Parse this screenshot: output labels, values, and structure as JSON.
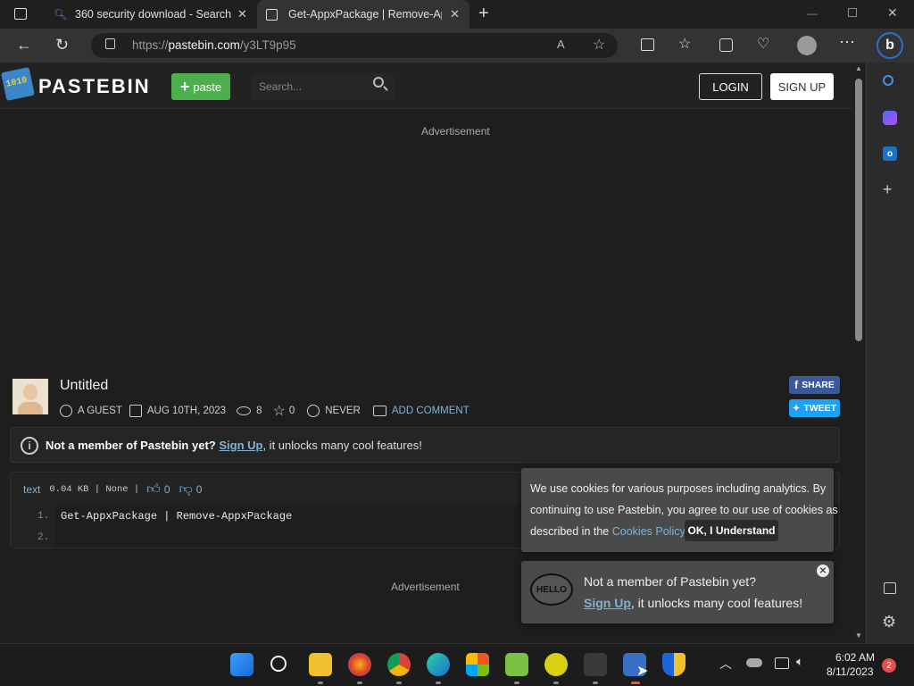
{
  "browser": {
    "tabs": [
      {
        "label": "360 security download - Search"
      },
      {
        "label": "Get-AppxPackage | Remove-AppxPackage"
      }
    ],
    "url_prefix": "https://",
    "url_domain": "pastebin.com",
    "url_path": "/y3LT9p95"
  },
  "header": {
    "logo_text": "PASTEBIN",
    "logo_icon_text": "1010",
    "paste_button": "paste",
    "search_placeholder": "Search...",
    "login": "LOGIN",
    "signup": "SIGN UP"
  },
  "ad_label_top": "Advertisement",
  "ad_label_bottom": "Advertisement",
  "paste": {
    "title": "Untitled",
    "author": "A GUEST",
    "date": "AUG 10TH, 2023",
    "views": "8",
    "stars": "0",
    "expires": "NEVER",
    "add_comment": "ADD COMMENT",
    "share": "SHARE",
    "tweet": "TWEET"
  },
  "notice": {
    "bold": "Not a member of Pastebin yet?",
    "link": "Sign Up",
    "rest": ", it unlocks many cool features!"
  },
  "code": {
    "syntax": "text",
    "size": "0.04 KB | None |",
    "likes": "0",
    "dislikes": "0",
    "lines": [
      {
        "num": "1.",
        "text": "Get-AppxPackage | Remove-AppxPackage"
      },
      {
        "num": "2.",
        "text": ""
      }
    ]
  },
  "cookie": {
    "line1": "We use cookies for various purposes including analytics. By",
    "line2": "continuing to use Pastebin, you agree to our use of cookies as",
    "line3_pre": "described in the",
    "link": "Cookies Policy",
    "line3_post": ".",
    "ok": "OK, I Understand"
  },
  "hello": {
    "badge": "HELLO",
    "line1": "Not a member of Pastebin yet?",
    "link": "Sign Up",
    "line2_rest": ", it unlocks many cool features!"
  },
  "taskbar": {
    "time": "6:02 AM",
    "date": "8/11/2023",
    "notifications": "2"
  },
  "colors": {
    "accent_green": "#4cae4c",
    "link_blue": "#7fb3d5",
    "facebook": "#3b5998",
    "twitter": "#1da1f2"
  }
}
